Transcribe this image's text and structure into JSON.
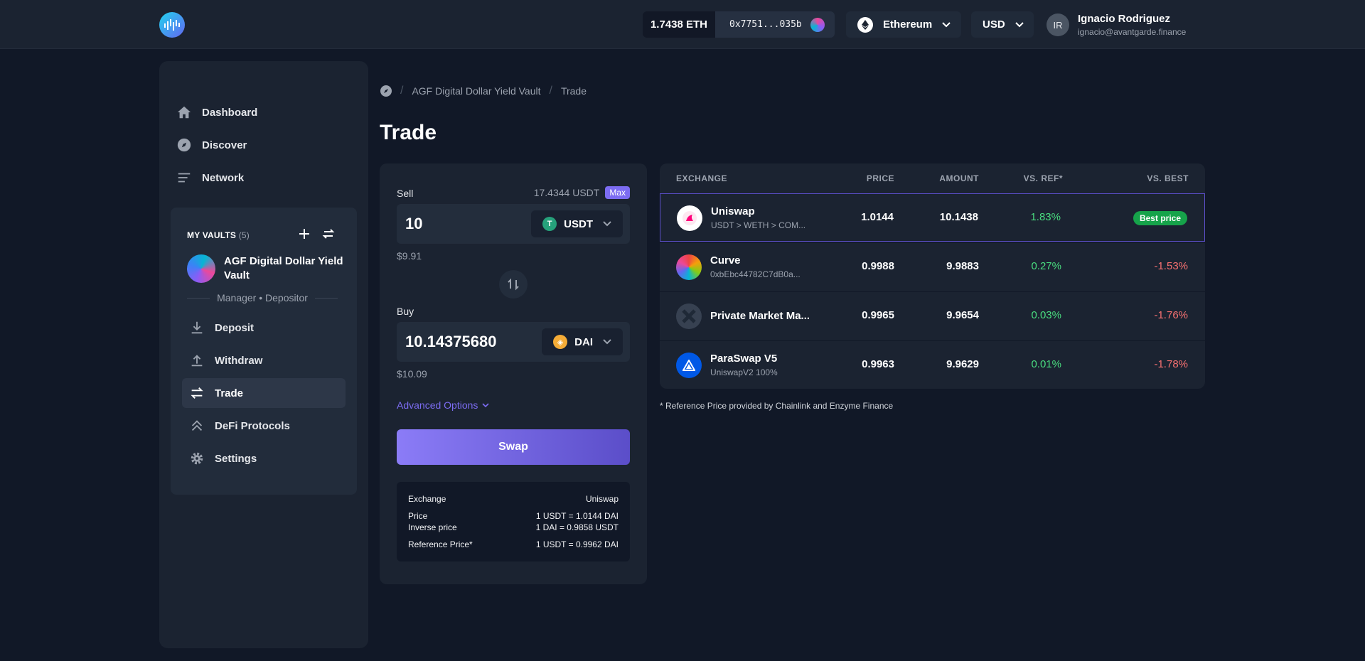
{
  "header": {
    "eth_balance": "1.7438 ETH",
    "wallet_address": "0x7751...035b",
    "network": "Ethereum",
    "currency": "USD",
    "user_initials": "IR",
    "user_name": "Ignacio Rodriguez",
    "user_email": "ignacio@avantgarde.finance"
  },
  "sidebar": {
    "nav": [
      {
        "label": "Dashboard",
        "icon": "home-icon"
      },
      {
        "label": "Discover",
        "icon": "compass-icon"
      },
      {
        "label": "Network",
        "icon": "list-icon"
      }
    ],
    "vaults_title": "MY VAULTS",
    "vaults_count": "(5)",
    "vault_name": "AGF Digital Dollar Yield Vault",
    "vault_role": "Manager • Depositor",
    "vault_items": [
      {
        "label": "Deposit",
        "icon": "download-icon"
      },
      {
        "label": "Withdraw",
        "icon": "upload-icon"
      },
      {
        "label": "Trade",
        "icon": "swap-icon",
        "active": true
      },
      {
        "label": "DeFi Protocols",
        "icon": "double-chevron-up-icon"
      },
      {
        "label": "Settings",
        "icon": "gear-icon"
      }
    ]
  },
  "breadcrumb": {
    "vault": "AGF Digital Dollar Yield Vault",
    "current": "Trade"
  },
  "page_title": "Trade",
  "trade": {
    "sell_label": "Sell",
    "sell_balance": "17.4344 USDT",
    "max_label": "Max",
    "sell_amount": "10",
    "sell_token": "USDT",
    "sell_usd": "$9.91",
    "buy_label": "Buy",
    "buy_amount": "10.14375680",
    "buy_token": "DAI",
    "buy_usd": "$10.09",
    "advanced_options": "Advanced Options",
    "swap_label": "Swap",
    "summary": {
      "exchange_label": "Exchange",
      "exchange_value": "Uniswap",
      "price_label": "Price",
      "price_value": "1 USDT = 1.0144 DAI",
      "inverse_label": "Inverse price",
      "inverse_value": "1 DAI = 0.9858 USDT",
      "ref_label": "Reference Price*",
      "ref_value": "1 USDT = 0.9962 DAI"
    }
  },
  "exchanges": {
    "headers": {
      "exchange": "EXCHANGE",
      "price": "PRICE",
      "amount": "AMOUNT",
      "vs_ref": "VS. REF*",
      "vs_best": "VS. BEST"
    },
    "rows": [
      {
        "name": "Uniswap",
        "route": "USDT > WETH > COM...",
        "price": "1.0144",
        "amount": "10.1438",
        "vs_ref": "1.83%",
        "vs_best": "Best price"
      },
      {
        "name": "Curve",
        "route": "0xbEbc44782C7dB0a...",
        "price": "0.9988",
        "amount": "9.9883",
        "vs_ref": "0.27%",
        "vs_best": "-1.53%"
      },
      {
        "name": "Private Market Ma...",
        "route": "",
        "price": "0.9965",
        "amount": "9.9654",
        "vs_ref": "0.03%",
        "vs_best": "-1.76%"
      },
      {
        "name": "ParaSwap V5",
        "route": "UniswapV2 100%",
        "price": "0.9963",
        "amount": "9.9629",
        "vs_ref": "0.01%",
        "vs_best": "-1.78%"
      }
    ],
    "footnote": "* Reference Price provided by Chainlink and Enzyme Finance"
  },
  "colors": {
    "background": "#111827",
    "panel": "#1b2331",
    "accent": "#7c6cf2",
    "positive": "#4ade80",
    "negative": "#f87171",
    "best_badge": "#16a34a"
  }
}
